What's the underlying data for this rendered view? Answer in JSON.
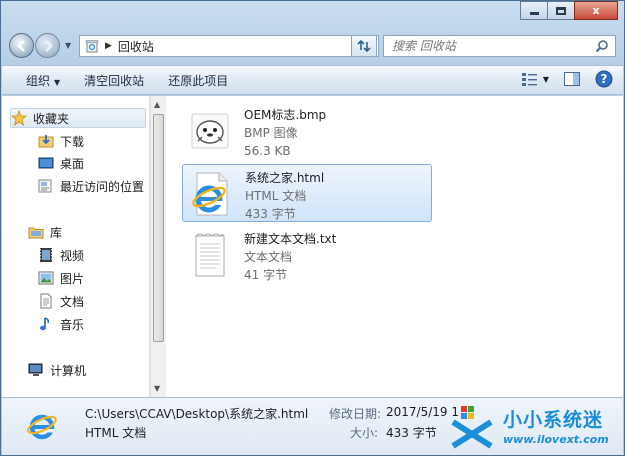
{
  "window": {
    "caption_close": "x"
  },
  "address": {
    "crumb": "回收站",
    "search_placeholder": "搜索 回收站"
  },
  "toolbar": {
    "organize": "组织",
    "empty_recycle_bin": "清空回收站",
    "restore_all": "还原此项目"
  },
  "sidebar": {
    "favorites": "收藏夹",
    "downloads": "下载",
    "desktop": "桌面",
    "recent": "最近访问的位置",
    "libraries": "库",
    "videos": "视频",
    "pictures": "图片",
    "documents": "文档",
    "music": "音乐",
    "computer": "计算机"
  },
  "files": [
    {
      "name": "OEM标志.bmp",
      "type": "BMP 图像",
      "size": "56.3 KB",
      "icon": "bmp-penguin-icon"
    },
    {
      "name": "系统之家.html",
      "type": "HTML 文档",
      "size": "433 字节",
      "icon": "ie-html-icon"
    },
    {
      "name": "新建文本文档.txt",
      "type": "文本文档",
      "size": "41 字节",
      "icon": "text-document-icon"
    }
  ],
  "details": {
    "path": "C:\\Users\\CCAV\\Desktop\\系统之家.html",
    "type": "HTML 文档",
    "modified_label": "修改日期:",
    "modified_value": "2017/5/19 1",
    "size_label": "大小:",
    "size_value": "433 字节"
  },
  "watermark": {
    "title": "小小系统迷",
    "url": "www.ilovext.com"
  },
  "colors": {
    "selection_fill": "#cfe3fa",
    "selection_border": "#84acdd",
    "watermark_blue": "#1a8fd7"
  }
}
